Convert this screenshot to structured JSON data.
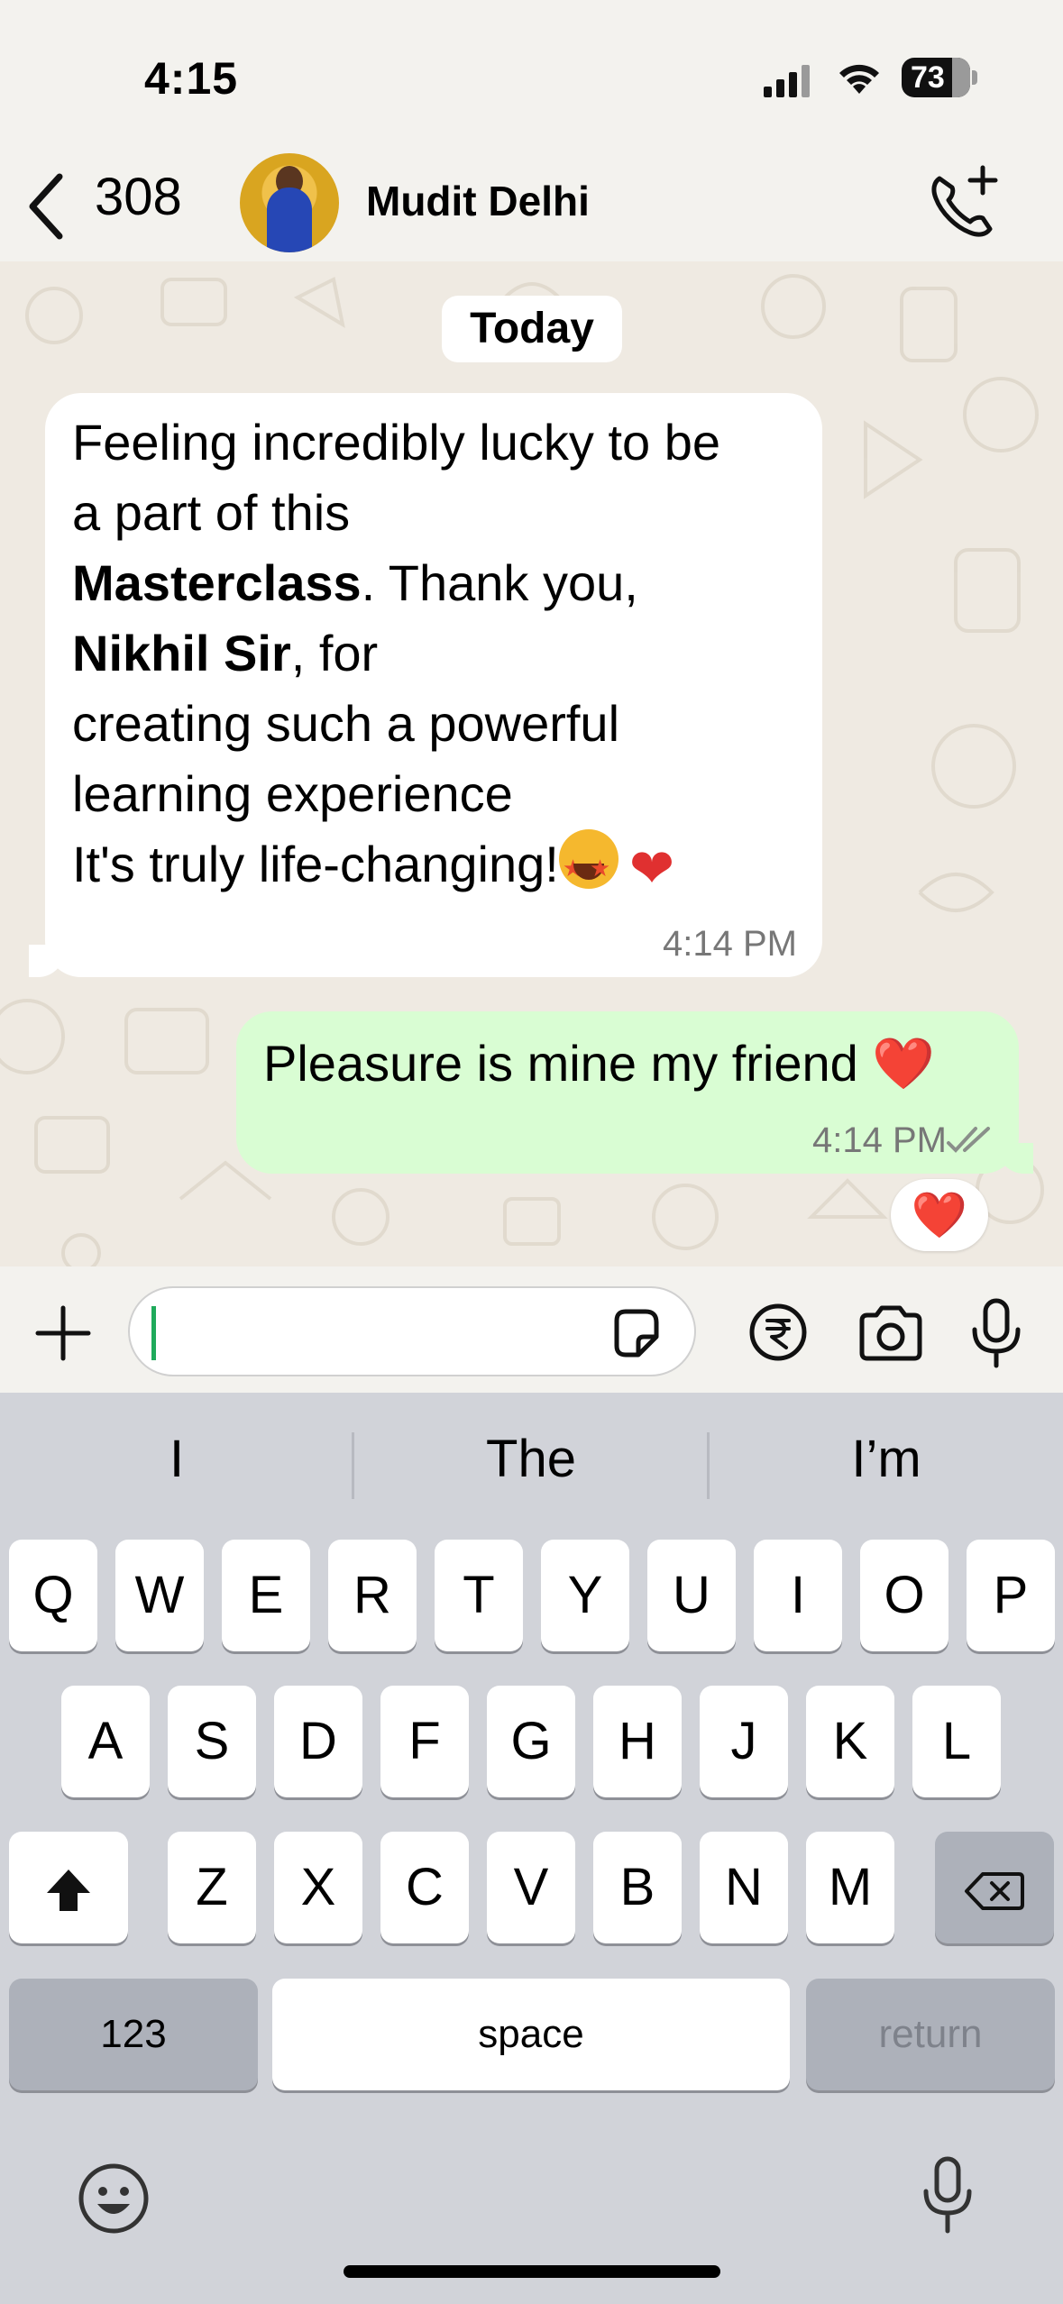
{
  "status_bar": {
    "time": "4:15",
    "battery": "73"
  },
  "header": {
    "unread_count": "308",
    "contact_name": "Mudit Delhi"
  },
  "chat": {
    "date_chip": "Today",
    "incoming": {
      "line1": "Feeling incredibly lucky to be",
      "line2": "a part of this",
      "bold1": "Masterclass",
      "line3_rest": ". Thank you,",
      "bold2": "Nikhil Sir",
      "line4_rest": ", for",
      "line5": "creating such a powerful",
      "line6": "learning experience",
      "line7": "It's truly life-changing!",
      "time": "4:14 PM"
    },
    "outgoing": {
      "text": "Pleasure is mine my friend ",
      "emoji": "❤️",
      "time": "4:14 PM"
    },
    "reaction": "❤️"
  },
  "composer": {
    "placeholder": ""
  },
  "keyboard": {
    "suggestions": [
      "I",
      "The",
      "I’m"
    ],
    "row1": [
      "Q",
      "W",
      "E",
      "R",
      "T",
      "Y",
      "U",
      "I",
      "O",
      "P"
    ],
    "row2": [
      "A",
      "S",
      "D",
      "F",
      "G",
      "H",
      "J",
      "K",
      "L"
    ],
    "row3": [
      "Z",
      "X",
      "C",
      "V",
      "B",
      "N",
      "M"
    ],
    "numbers_label": "123",
    "space_label": "space",
    "return_label": "return"
  },
  "colors": {
    "accent": "#1faa5b",
    "outgoing_bubble": "#d9fdd3",
    "heart": "#e81d2a"
  }
}
